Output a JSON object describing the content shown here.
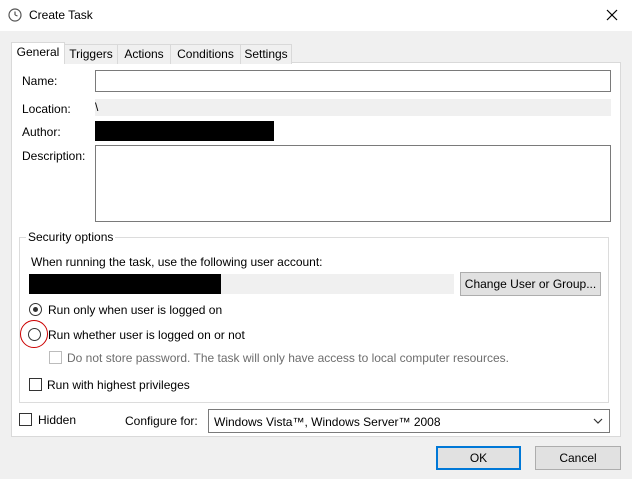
{
  "window": {
    "title": "Create Task"
  },
  "tabs": [
    "General",
    "Triggers",
    "Actions",
    "Conditions",
    "Settings"
  ],
  "general": {
    "name_label": "Name:",
    "name_value": "",
    "location_label": "Location:",
    "location_value": "\\",
    "author_label": "Author:",
    "description_label": "Description:",
    "description_value": ""
  },
  "security": {
    "legend": "Security options",
    "account_prompt": "When running the task, use the following user account:",
    "change_user_button": "Change User or Group...",
    "radio_logged_on": "Run only when user is logged on",
    "radio_whether": "Run whether user is logged on or not",
    "dont_store_password": "Do not store password.  The task will only have access to local computer resources.",
    "highest_privileges": "Run with highest privileges"
  },
  "footer": {
    "hidden_label": "Hidden",
    "configure_label": "Configure for:",
    "configure_value": "Windows Vista™, Windows Server™ 2008",
    "ok_button": "OK",
    "cancel_button": "Cancel"
  }
}
